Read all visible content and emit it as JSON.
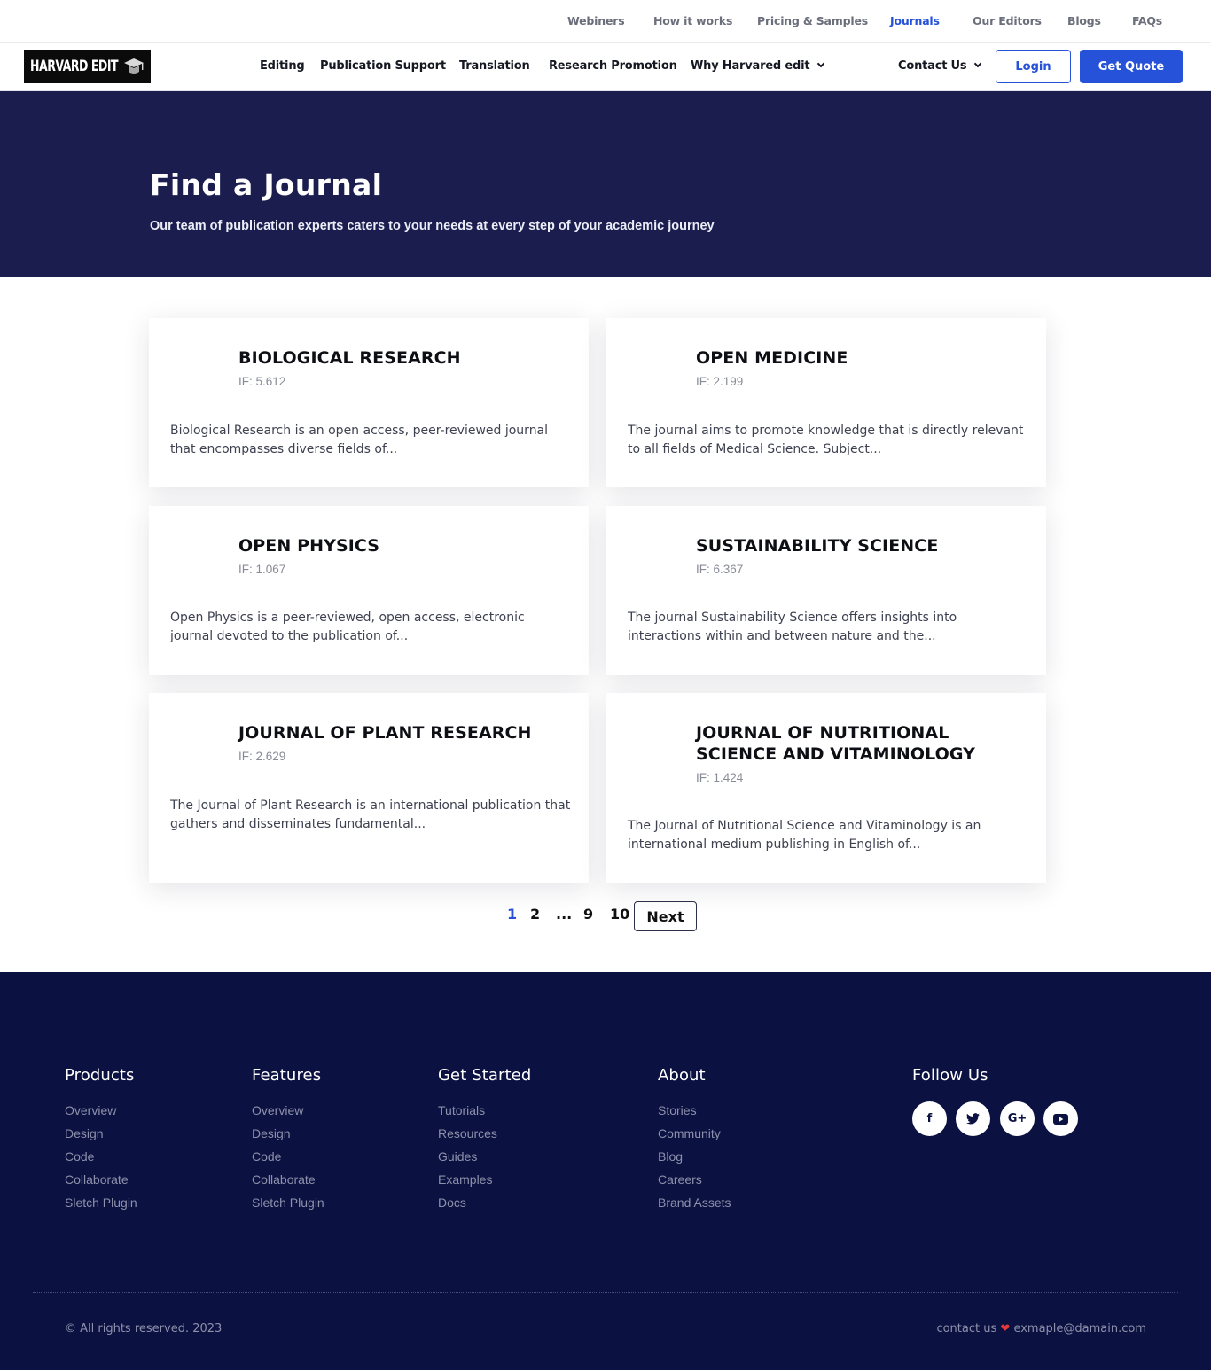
{
  "topbar": {
    "links": [
      "Webiners",
      "How it works",
      "Pricing & Samples",
      "Journals",
      "Our Editors",
      "Blogs",
      "FAQs"
    ],
    "active": "Journals"
  },
  "header": {
    "logo_text": "HARVARD EDIT",
    "nav": [
      "Editing",
      "Publication Support",
      "Translation",
      "Research Promotion",
      "Why Harvared edit"
    ],
    "contact_label": "Contact Us",
    "login_label": "Login",
    "quote_label": "Get Quote"
  },
  "hero": {
    "title": "Find a Journal",
    "subtitle": "Our team of publication experts caters to your needs at every step of your academic journey"
  },
  "journals": [
    {
      "title": "BIOLOGICAL RESEARCH",
      "if": "IF: 5.612",
      "desc": "Biological Research is an open access, peer-reviewed journal that encompasses diverse fields of..."
    },
    {
      "title": "OPEN MEDICINE",
      "if": "IF: 2.199",
      "desc": "The journal aims to promote knowledge that is directly relevant to all fields of Medical Science. Subject..."
    },
    {
      "title": "OPEN PHYSICS",
      "if": "IF: 1.067",
      "desc": "Open Physics is a peer-reviewed, open access, electronic journal devoted to the publication of..."
    },
    {
      "title": "SUSTAINABILITY SCIENCE",
      "if": "IF: 6.367",
      "desc": "The journal Sustainability Science offers insights into interactions within and between nature and the..."
    },
    {
      "title": "JOURNAL OF PLANT RESEARCH",
      "if": "IF: 2.629",
      "desc": "The Journal of Plant Research is an international publication that gathers and disseminates fundamental..."
    },
    {
      "title": "JOURNAL OF NUTRITIONAL SCIENCE AND VITAMINOLOGY",
      "if": "IF: 1.424",
      "desc": "The Journal of Nutritional Science and Vitaminology is an international medium publishing in English of..."
    }
  ],
  "pagination": {
    "pages": [
      "1",
      "2",
      "...",
      "9",
      "10"
    ],
    "current": "1",
    "next_label": "Next"
  },
  "footer": {
    "columns": [
      {
        "heading": "Products",
        "items": [
          "Overview",
          "Design",
          "Code",
          "Collaborate",
          "Sletch Plugin"
        ]
      },
      {
        "heading": "Features",
        "items": [
          "Overview",
          "Design",
          "Code",
          "Collaborate",
          "Sletch Plugin"
        ]
      },
      {
        "heading": "Get Started",
        "items": [
          "Tutorials",
          "Resources",
          "Guides",
          "Examples",
          "Docs"
        ]
      },
      {
        "heading": "About",
        "items": [
          "Stories",
          "Community",
          "Blog",
          "Careers",
          "Brand Assets"
        ]
      }
    ],
    "follow_heading": "Follow Us",
    "social": [
      {
        "icon": "facebook-icon",
        "glyph": "f"
      },
      {
        "icon": "twitter-icon",
        "glyph": "t"
      },
      {
        "icon": "google-plus-icon",
        "glyph": "G+"
      },
      {
        "icon": "youtube-icon",
        "glyph": "▶"
      }
    ],
    "copyright": "© All rights reserved. 2023",
    "contact_prefix": "contact us",
    "contact_heart": "❤",
    "contact_email": "exmaple@damain.com"
  },
  "colors": {
    "accent": "#2651d9",
    "hero_bg": "#1b1d4f",
    "footer_bg": "#0b1140"
  }
}
